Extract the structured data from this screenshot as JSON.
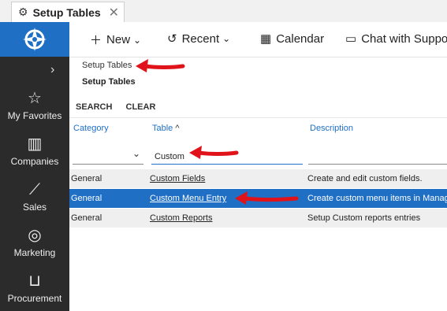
{
  "tab": {
    "title": "Setup Tables",
    "close": "✕",
    "icon": "gear-icon"
  },
  "sidebar": {
    "expand": "›",
    "items": [
      {
        "label": "My Favorites",
        "icon": "star-icon"
      },
      {
        "label": "Companies",
        "icon": "building-icon"
      },
      {
        "label": "Sales",
        "icon": "chart-icon"
      },
      {
        "label": "Marketing",
        "icon": "target-icon"
      },
      {
        "label": "Procurement",
        "icon": "cart-icon"
      }
    ]
  },
  "toolbar": {
    "new": "New",
    "recent": "Recent",
    "calendar": "Calendar",
    "chat": "Chat with Support"
  },
  "breadcrumb": {
    "link": "Setup Tables",
    "title": "Setup Tables"
  },
  "actions": {
    "search": "SEARCH",
    "clear": "CLEAR"
  },
  "columns": {
    "category": "Category",
    "table": "Table",
    "table_sort": "^",
    "description": "Description"
  },
  "filters": {
    "category": "",
    "table": "Custom",
    "description": ""
  },
  "rows": [
    {
      "category": "General",
      "table": "Custom Fields",
      "description": "Create and edit custom fields."
    },
    {
      "category": "General",
      "table": "Custom Menu Entry",
      "description": "Create custom menu items in Manage"
    },
    {
      "category": "General",
      "table": "Custom Reports",
      "description": "Setup Custom reports entries"
    }
  ],
  "colors": {
    "accent": "#1f6fc5",
    "sidebar": "#2b2b2b",
    "annotation": "#e0131a"
  }
}
